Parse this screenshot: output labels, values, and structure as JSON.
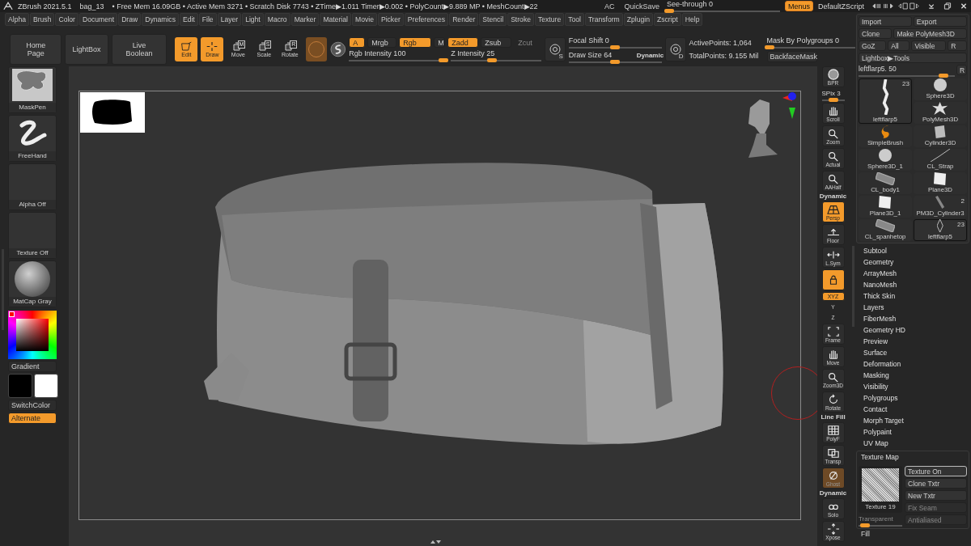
{
  "title_bar": {
    "app": "ZBrush 2021.5.1",
    "document": "bag_13",
    "stats": "• Free Mem 16.09GB • Active Mem 3271 • Scratch Disk 7743 • ZTime▶1.011 Timer▶0.002 • PolyCount▶9.889 MP • MeshCount▶22",
    "buttons": [
      {
        "label": "AC",
        "on": false
      },
      {
        "label": "QuickSave",
        "on": false
      }
    ],
    "see_through": {
      "label": "See-through",
      "value": "0",
      "level": 0.02
    },
    "menus_button": {
      "label": "Menus",
      "on": true
    },
    "script_label": "DefaultZScript"
  },
  "menu_bar": [
    "Alpha",
    "Brush",
    "Color",
    "Document",
    "Draw",
    "Dynamics",
    "Edit",
    "File",
    "Layer",
    "Light",
    "Macro",
    "Marker",
    "Material",
    "Movie",
    "Picker",
    "Preferences",
    "Render",
    "Stencil",
    "Stroke",
    "Texture",
    "Tool",
    "Transform",
    "Zplugin",
    "Zscript",
    "Help"
  ],
  "top_shelf": {
    "nav_buttons": [
      "Home Page",
      "LightBox",
      "Live Boolean"
    ],
    "modes": [
      {
        "label": "Edit",
        "kind": "edit",
        "on": true
      },
      {
        "label": "Draw",
        "kind": "draw",
        "on": true
      },
      {
        "label": "Move",
        "kind": "stack",
        "letter": "M",
        "on": false
      },
      {
        "label": "Scale",
        "kind": "stack",
        "letter": "S",
        "on": false
      },
      {
        "label": "Rotate",
        "kind": "stack",
        "letter": "R",
        "on": false
      }
    ],
    "channel_toggles": [
      {
        "label": "A",
        "on": true,
        "disabled": false
      },
      {
        "label": "Mrgb",
        "on": false,
        "disabled": false
      },
      {
        "label": "Rgb",
        "on": true,
        "disabled": false
      },
      {
        "label": "M",
        "on": false,
        "disabled": false
      },
      {
        "label": "Zadd",
        "on": true,
        "disabled": false
      },
      {
        "label": "Zsub",
        "on": false,
        "disabled": false
      },
      {
        "label": "Zcut",
        "on": false,
        "disabled": true
      }
    ],
    "intensity_sliders": [
      {
        "label": "Rgb Intensity",
        "value": "100",
        "level": 0.97
      },
      {
        "label": "Z Intensity",
        "value": "25",
        "level": 0.45
      }
    ],
    "focal_button": {
      "letter": "S"
    },
    "brush_sliders": [
      {
        "label": "Focal Shift",
        "value": "0",
        "level": 0.5
      },
      {
        "label": "Draw Size",
        "value": "64",
        "level": 0.5
      }
    ],
    "dynamic_label": "Dynamic",
    "points_button": {
      "letter": "D"
    },
    "active_points": "ActivePoints: 1,064",
    "total_points": "TotalPoints: 9.155 Mil",
    "mask_slider": {
      "label": "Mask By Polygroups",
      "value": "0",
      "level": 0.03
    },
    "backface_button": "BackfaceMask"
  },
  "left_shelf": {
    "thumbnails": [
      {
        "label": "MaskPen",
        "kind": "mask-brush"
      },
      {
        "label": "FreeHand",
        "kind": "stroke"
      },
      {
        "label": "Alpha Off",
        "kind": "empty"
      },
      {
        "label": "Texture Off",
        "kind": "empty"
      },
      {
        "label": "MatCap Gray",
        "kind": "sphere"
      }
    ],
    "gradient_button": "Gradient",
    "swatches": [
      {
        "color": "#000000"
      },
      {
        "color": "#ffffff"
      }
    ],
    "switch_button": "SwitchColor",
    "alternate": {
      "label": "Alternate",
      "on": true
    }
  },
  "right_shelf": [
    {
      "label": "BPR",
      "kind": "sphere",
      "on": false,
      "muted": false
    },
    {
      "label": "SPix",
      "value": "3",
      "kind": "slider",
      "level": 0.5
    },
    {
      "label": "Scroll",
      "kind": "hand",
      "on": false,
      "muted": false
    },
    {
      "label": "Zoom",
      "kind": "magnifier",
      "on": false,
      "muted": false
    },
    {
      "label": "Actual",
      "kind": "magnifier",
      "on": false,
      "muted": false
    },
    {
      "label": "AAHalf",
      "kind": "magnifier",
      "on": false,
      "muted": false
    },
    {
      "caption": "Dynamic",
      "label": "Persp",
      "kind": "persp",
      "on": true,
      "muted": false
    },
    {
      "label": "Floor",
      "kind": "floor",
      "on": false,
      "muted": false
    },
    {
      "label": "L.Sym",
      "kind": "sym",
      "on": false,
      "muted": false
    },
    {
      "kind": "lock",
      "on": true,
      "muted": false
    },
    {
      "label": "XYZ",
      "kind": "small",
      "on": true,
      "muted": false
    },
    {
      "label": "Y",
      "kind": "mini",
      "on": false,
      "muted": false
    },
    {
      "label": "Z",
      "kind": "mini",
      "on": false,
      "muted": false
    },
    {
      "label": "Frame",
      "kind": "frame",
      "on": false,
      "muted": false
    },
    {
      "label": "Move",
      "kind": "hand",
      "on": false,
      "muted": false
    },
    {
      "label": "Zoom3D",
      "kind": "magnifier",
      "on": false,
      "muted": false
    },
    {
      "label": "Rotate",
      "kind": "rotate",
      "on": false,
      "muted": false
    },
    {
      "caption": "Line Fill",
      "label": "PolyF",
      "kind": "grid",
      "on": false,
      "muted": false
    },
    {
      "label": "Transp",
      "kind": "transp",
      "on": false,
      "muted": false
    },
    {
      "label": "Ghost",
      "kind": "ghost",
      "on": false,
      "muted": true
    },
    {
      "caption": "Dynamic",
      "label": "Solo",
      "kind": "solo",
      "on": false,
      "muted": false
    },
    {
      "label": "Xpose",
      "kind": "xpose",
      "on": false,
      "muted": false
    }
  ],
  "right_panel": {
    "button_rows": [
      [
        "Import",
        "Export"
      ],
      [
        "Clone",
        "Make PolyMesh3D"
      ],
      [
        "GoZ",
        "All",
        "Visible",
        "R"
      ],
      [
        "Lightbox▶Tools"
      ]
    ],
    "tool_slider": {
      "label": "leftflarp5.",
      "value": "50",
      "level": 0.88
    },
    "reset_button": "R",
    "tools": [
      {
        "label": "leftflarp5",
        "count": "23",
        "kind": "strip",
        "current": true,
        "selected": true
      },
      {
        "label": "Sphere3D",
        "kind": "sphere",
        "current": false,
        "selected": false
      },
      {
        "label": "PolyMesh3D",
        "kind": "star",
        "current": false,
        "selected": false
      },
      {
        "label": "SimpleBrush",
        "kind": "flame",
        "current": false,
        "selected": false
      },
      {
        "label": "Cylinder3D",
        "kind": "cylinder",
        "current": false,
        "selected": false
      },
      {
        "label": "Sphere3D_1",
        "kind": "sphere",
        "current": false,
        "selected": false
      },
      {
        "label": "CL_Strap",
        "kind": "curve",
        "current": false,
        "selected": false
      },
      {
        "label": "CL_body1",
        "kind": "mesh",
        "current": false,
        "selected": false
      },
      {
        "label": "Plane3D",
        "kind": "cube",
        "current": false,
        "selected": false
      },
      {
        "label": "Plane3D_1",
        "kind": "cube",
        "current": false,
        "selected": false
      },
      {
        "label": "PM3D_Cylinder3",
        "count": "2",
        "kind": "tube",
        "current": false,
        "selected": false
      },
      {
        "label": "CL_spanhetop",
        "kind": "mesh",
        "current": false,
        "selected": false
      },
      {
        "label": "leftflarp5",
        "count": "23",
        "kind": "diamond",
        "current": false,
        "selected": true
      }
    ],
    "sections": [
      "Subtool",
      "Geometry",
      "ArrayMesh",
      "NanoMesh",
      "Thick Skin",
      "Layers",
      "FiberMesh",
      "Geometry HD",
      "Preview",
      "Surface",
      "Deformation",
      "Masking",
      "Visibility",
      "Polygroups",
      "Contact",
      "Morph Target",
      "Polypaint",
      "UV Map"
    ],
    "texture_map": {
      "title": "Texture Map",
      "thumbnail_label": "Texture 19",
      "buttons": [
        {
          "label": "Texture On",
          "selected": true,
          "disabled": false
        },
        {
          "label": "Clone Txtr",
          "selected": false,
          "disabled": false
        },
        {
          "label": "New Txtr",
          "selected": false,
          "disabled": false
        },
        {
          "label": "Fix Seam",
          "selected": false,
          "disabled": true
        }
      ],
      "transparent_slider": {
        "label": "Transparent",
        "level": 0.15,
        "disabled": true
      },
      "antialiased_button": {
        "label": "Antialiased",
        "disabled": true
      }
    },
    "fill_label": "Fill"
  }
}
